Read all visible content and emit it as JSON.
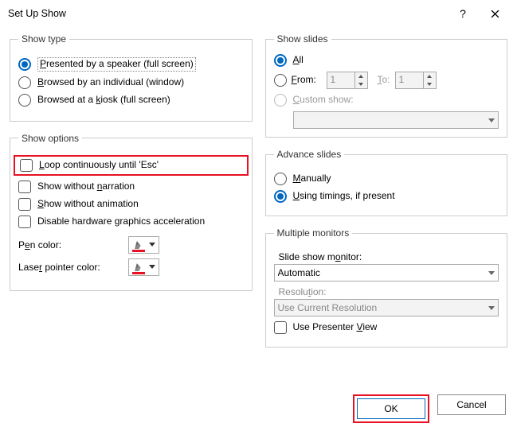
{
  "title": "Set Up Show",
  "groups": {
    "show_type": "Show type",
    "show_options": "Show options",
    "show_slides": "Show slides",
    "advance_slides": "Advance slides",
    "monitors": "Multiple monitors"
  },
  "show_type": {
    "speaker": "Presented by a speaker (full screen)",
    "individual": "Browsed by an individual (window)",
    "kiosk": "Browsed at a kiosk (full screen)"
  },
  "show_options": {
    "loop": "Loop continuously until 'Esc'",
    "no_narration": "Show without narration",
    "no_animation": "Show without animation",
    "disable_hw": "Disable hardware graphics acceleration",
    "pen_color": "Pen color:",
    "laser_color": "Laser pointer color:"
  },
  "show_slides": {
    "all": "All",
    "from": "From:",
    "to": "To:",
    "from_val": "1",
    "to_val": "1",
    "custom": "Custom show:"
  },
  "advance": {
    "manual": "Manually",
    "timings": "Using timings, if present"
  },
  "monitors": {
    "monitor_label": "Slide show monitor:",
    "monitor_value": "Automatic",
    "res_label": "Resolution:",
    "res_value": "Use Current Resolution",
    "presenter": "Use Presenter View"
  },
  "buttons": {
    "ok": "OK",
    "cancel": "Cancel"
  }
}
